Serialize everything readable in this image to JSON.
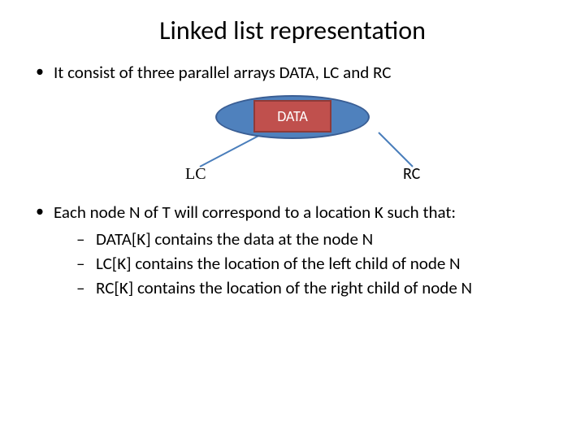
{
  "title": "Linked list representation",
  "bullet1": "It consist of three parallel arrays DATA, LC and RC",
  "diagram": {
    "data_label": "DATA",
    "lc_label": "LC",
    "rc_label": "RC"
  },
  "bullet2": "Each node N of T will correspond to a location K such that:",
  "sub": {
    "a": "DATA[K] contains the data at the node N",
    "b": "LC[K] contains the location of the left child of node N",
    "c": "RC[K] contains the location of the right child of node N"
  }
}
